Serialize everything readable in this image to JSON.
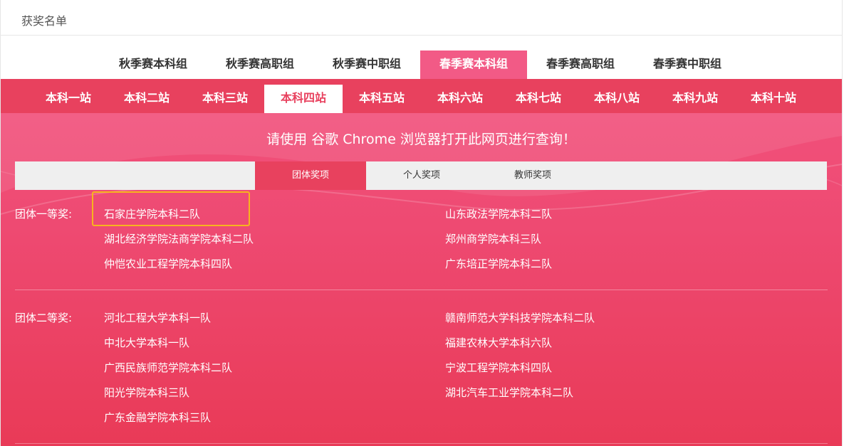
{
  "header": {
    "title": "获奖名单"
  },
  "season_tabs": [
    {
      "label": "秋季赛本科组",
      "active": false
    },
    {
      "label": "秋季赛高职组",
      "active": false
    },
    {
      "label": "秋季赛中职组",
      "active": false
    },
    {
      "label": "春季赛本科组",
      "active": true
    },
    {
      "label": "春季赛高职组",
      "active": false
    },
    {
      "label": "春季赛中职组",
      "active": false
    }
  ],
  "station_tabs": [
    {
      "label": "本科一站",
      "active": false
    },
    {
      "label": "本科二站",
      "active": false
    },
    {
      "label": "本科三站",
      "active": false
    },
    {
      "label": "本科四站",
      "active": true
    },
    {
      "label": "本科五站",
      "active": false
    },
    {
      "label": "本科六站",
      "active": false
    },
    {
      "label": "本科七站",
      "active": false
    },
    {
      "label": "本科八站",
      "active": false
    },
    {
      "label": "本科九站",
      "active": false
    },
    {
      "label": "本科十站",
      "active": false
    }
  ],
  "notice": "请使用 谷歌 Chrome 浏览器打开此网页进行查询！",
  "award_tabs": [
    {
      "label": "团体奖项",
      "active": true
    },
    {
      "label": "个人奖项",
      "active": false
    },
    {
      "label": "教师奖项",
      "active": false
    }
  ],
  "sections": [
    {
      "label": "团体一等奖:",
      "left": [
        "石家庄学院本科二队",
        "湖北经济学院法商学院本科二队",
        "仲恺农业工程学院本科四队"
      ],
      "right": [
        "山东政法学院本科二队",
        "郑州商学院本科三队",
        "广东培正学院本科二队"
      ]
    },
    {
      "label": "团体二等奖:",
      "left": [
        "河北工程大学本科一队",
        "中北大学本科一队",
        "广西民族师范学院本科二队",
        "阳光学院本科三队",
        "广东金融学院本科三队"
      ],
      "right": [
        "赣南师范大学科技学院本科二队",
        "福建农林大学本科六队",
        "宁波工程学院本科四队",
        "湖北汽车工业学院本科二队"
      ]
    }
  ],
  "colors": {
    "accent": "#e8415e",
    "season_active": "#f25a86",
    "highlight": "#f7b41e"
  }
}
